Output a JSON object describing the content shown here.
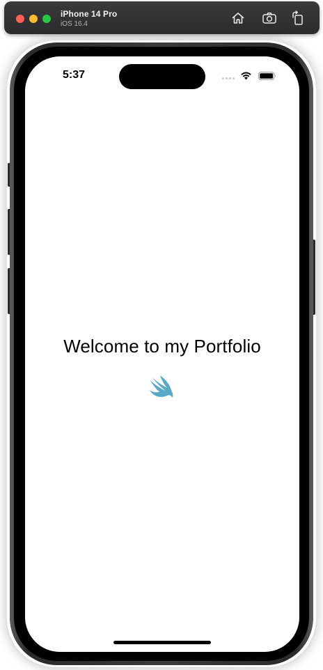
{
  "simulator": {
    "device_name": "iPhone 14 Pro",
    "os_version": "iOS 16.4",
    "buttons": {
      "home": "home-icon",
      "screenshot": "camera-icon",
      "rotate": "rotate-icon"
    }
  },
  "status_bar": {
    "time": "5:37",
    "icons": [
      "signal-dots-icon",
      "wifi-icon",
      "battery-icon"
    ]
  },
  "content": {
    "title": "Welcome to my Portfolio",
    "logo": "swift-logo-icon",
    "logo_color": "#5aaac7"
  }
}
